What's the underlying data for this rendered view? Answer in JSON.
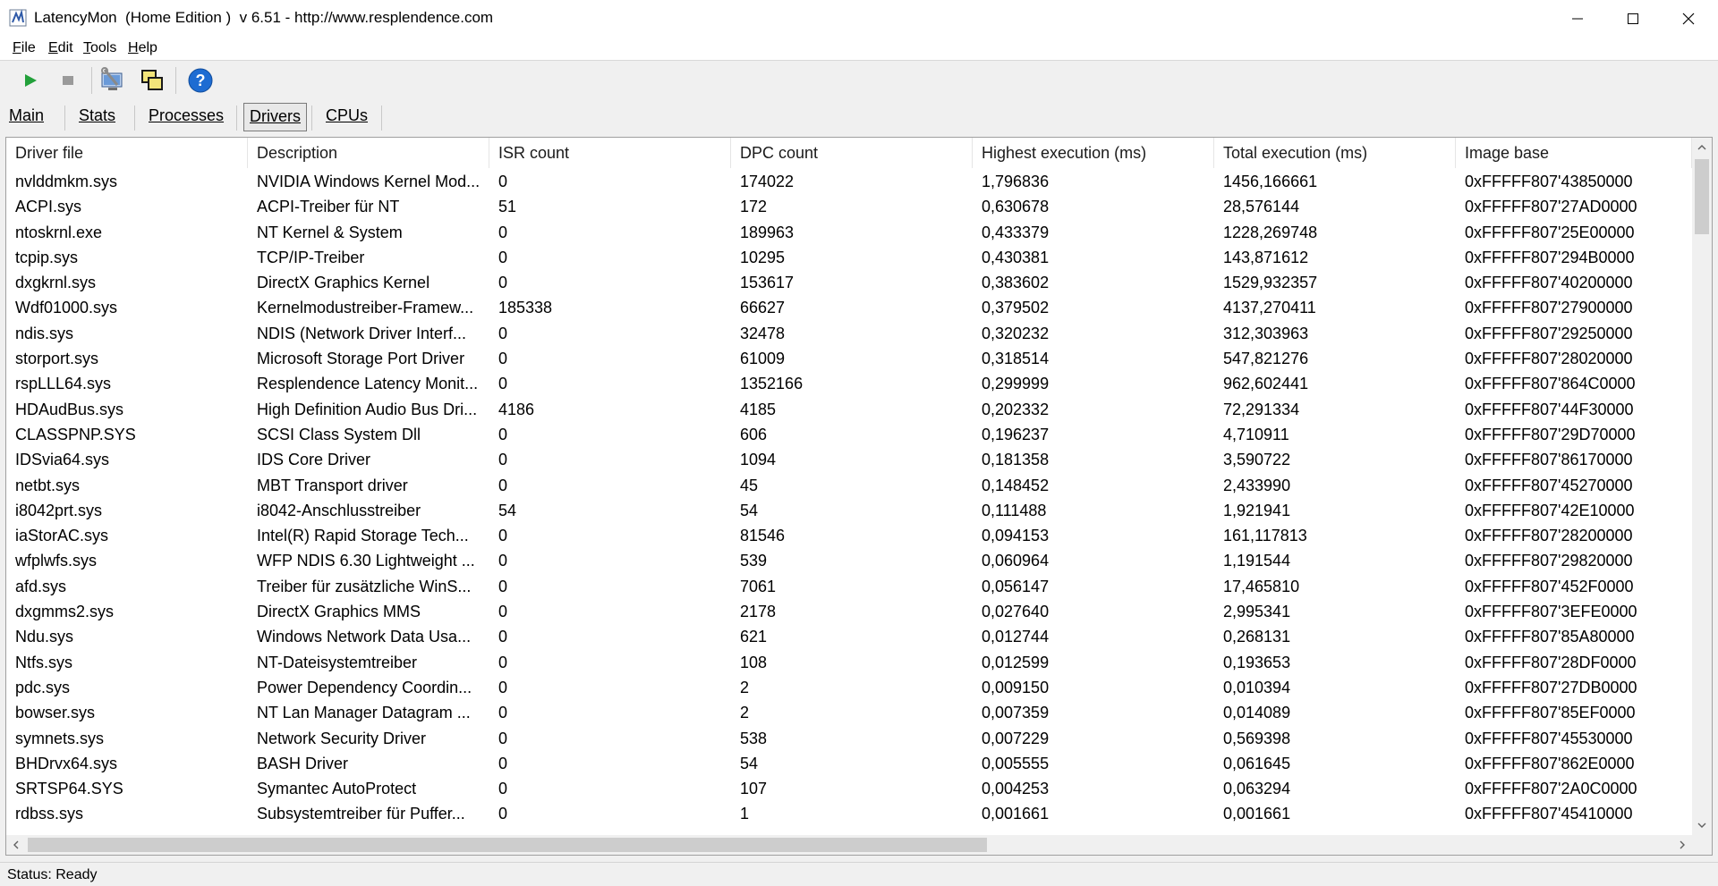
{
  "window": {
    "title": "LatencyMon  (Home Edition )  v 6.51 - http://www.resplendence.com",
    "app_icon": "latencymon-app-icon"
  },
  "menu": [
    {
      "accel": "F",
      "rest": "ile"
    },
    {
      "accel": "E",
      "rest": "dit"
    },
    {
      "accel": "T",
      "rest": "ools"
    },
    {
      "accel": "H",
      "rest": "elp"
    }
  ],
  "toolbar": {
    "icons": [
      "play-icon",
      "stop-icon",
      "wrench-computer-icon",
      "copy-windows-icon",
      "help-icon"
    ],
    "colors": {
      "play": "#22a03a",
      "stop": "#9a9a9a",
      "help": "#1e6cd2"
    }
  },
  "tabs": [
    {
      "label": "Main",
      "active": false
    },
    {
      "label": "Stats",
      "active": false
    },
    {
      "label": "Processes",
      "active": false
    },
    {
      "label": "Drivers",
      "active": true
    },
    {
      "label": "CPUs",
      "active": false
    }
  ],
  "table": {
    "columns": [
      "Driver file",
      "Description",
      "ISR count",
      "DPC count",
      "Highest execution (ms)",
      "Total execution (ms)",
      "Image base"
    ],
    "rows": [
      [
        "nvlddmkm.sys",
        "NVIDIA Windows Kernel Mod...",
        "0",
        "174022",
        "1,796836",
        "1456,166661",
        "0xFFFFF807'43850000"
      ],
      [
        "ACPI.sys",
        "ACPI-Treiber für NT",
        "51",
        "172",
        "0,630678",
        "28,576144",
        "0xFFFFF807'27AD0000"
      ],
      [
        "ntoskrnl.exe",
        "NT Kernel & System",
        "0",
        "189963",
        "0,433379",
        "1228,269748",
        "0xFFFFF807'25E00000"
      ],
      [
        "tcpip.sys",
        "TCP/IP-Treiber",
        "0",
        "10295",
        "0,430381",
        "143,871612",
        "0xFFFFF807'294B0000"
      ],
      [
        "dxgkrnl.sys",
        "DirectX Graphics Kernel",
        "0",
        "153617",
        "0,383602",
        "1529,932357",
        "0xFFFFF807'40200000"
      ],
      [
        "Wdf01000.sys",
        "Kernelmodustreiber-Framew...",
        "185338",
        "66627",
        "0,379502",
        "4137,270411",
        "0xFFFFF807'27900000"
      ],
      [
        "ndis.sys",
        "NDIS (Network Driver Interf...",
        "0",
        "32478",
        "0,320232",
        "312,303963",
        "0xFFFFF807'29250000"
      ],
      [
        "storport.sys",
        "Microsoft Storage Port Driver",
        "0",
        "61009",
        "0,318514",
        "547,821276",
        "0xFFFFF807'28020000"
      ],
      [
        "rspLLL64.sys",
        "Resplendence Latency Monit...",
        "0",
        "1352166",
        "0,299999",
        "962,602441",
        "0xFFFFF807'864C0000"
      ],
      [
        "HDAudBus.sys",
        "High Definition Audio Bus Dri...",
        "4186",
        "4185",
        "0,202332",
        "72,291334",
        "0xFFFFF807'44F30000"
      ],
      [
        "CLASSPNP.SYS",
        "SCSI Class System Dll",
        "0",
        "606",
        "0,196237",
        "4,710911",
        "0xFFFFF807'29D70000"
      ],
      [
        "IDSvia64.sys",
        "IDS Core Driver",
        "0",
        "1094",
        "0,181358",
        "3,590722",
        "0xFFFFF807'86170000"
      ],
      [
        "netbt.sys",
        "MBT Transport driver",
        "0",
        "45",
        "0,148452",
        "2,433990",
        "0xFFFFF807'45270000"
      ],
      [
        "i8042prt.sys",
        "i8042-Anschlusstreiber",
        "54",
        "54",
        "0,111488",
        "1,921941",
        "0xFFFFF807'42E10000"
      ],
      [
        "iaStorAC.sys",
        "Intel(R) Rapid Storage Tech...",
        "0",
        "81546",
        "0,094153",
        "161,117813",
        "0xFFFFF807'28200000"
      ],
      [
        "wfplwfs.sys",
        "WFP NDIS 6.30 Lightweight ...",
        "0",
        "539",
        "0,060964",
        "1,191544",
        "0xFFFFF807'29820000"
      ],
      [
        "afd.sys",
        "Treiber für zusätzliche WinS...",
        "0",
        "7061",
        "0,056147",
        "17,465810",
        "0xFFFFF807'452F0000"
      ],
      [
        "dxgmms2.sys",
        "DirectX Graphics MMS",
        "0",
        "2178",
        "0,027640",
        "2,995341",
        "0xFFFFF807'3EFE0000"
      ],
      [
        "Ndu.sys",
        "Windows Network Data Usa...",
        "0",
        "621",
        "0,012744",
        "0,268131",
        "0xFFFFF807'85A80000"
      ],
      [
        "Ntfs.sys",
        "NT-Dateisystemtreiber",
        "0",
        "108",
        "0,012599",
        "0,193653",
        "0xFFFFF807'28DF0000"
      ],
      [
        "pdc.sys",
        "Power Dependency Coordin...",
        "0",
        "2",
        "0,009150",
        "0,010394",
        "0xFFFFF807'27DB0000"
      ],
      [
        "bowser.sys",
        "NT Lan Manager Datagram ...",
        "0",
        "2",
        "0,007359",
        "0,014089",
        "0xFFFFF807'85EF0000"
      ],
      [
        "symnets.sys",
        "Network Security Driver",
        "0",
        "538",
        "0,007229",
        "0,569398",
        "0xFFFFF807'45530000"
      ],
      [
        "BHDrvx64.sys",
        "BASH Driver",
        "0",
        "54",
        "0,005555",
        "0,061645",
        "0xFFFFF807'862E0000"
      ],
      [
        "SRTSP64.SYS",
        "Symantec AutoProtect",
        "0",
        "107",
        "0,004253",
        "0,063294",
        "0xFFFFF807'2A0C0000"
      ],
      [
        "rdbss.sys",
        "Subsystemtreiber für Puffer...",
        "0",
        "1",
        "0,001661",
        "0,001661",
        "0xFFFFF807'45410000"
      ]
    ]
  },
  "status": {
    "text": "Status: Ready"
  }
}
